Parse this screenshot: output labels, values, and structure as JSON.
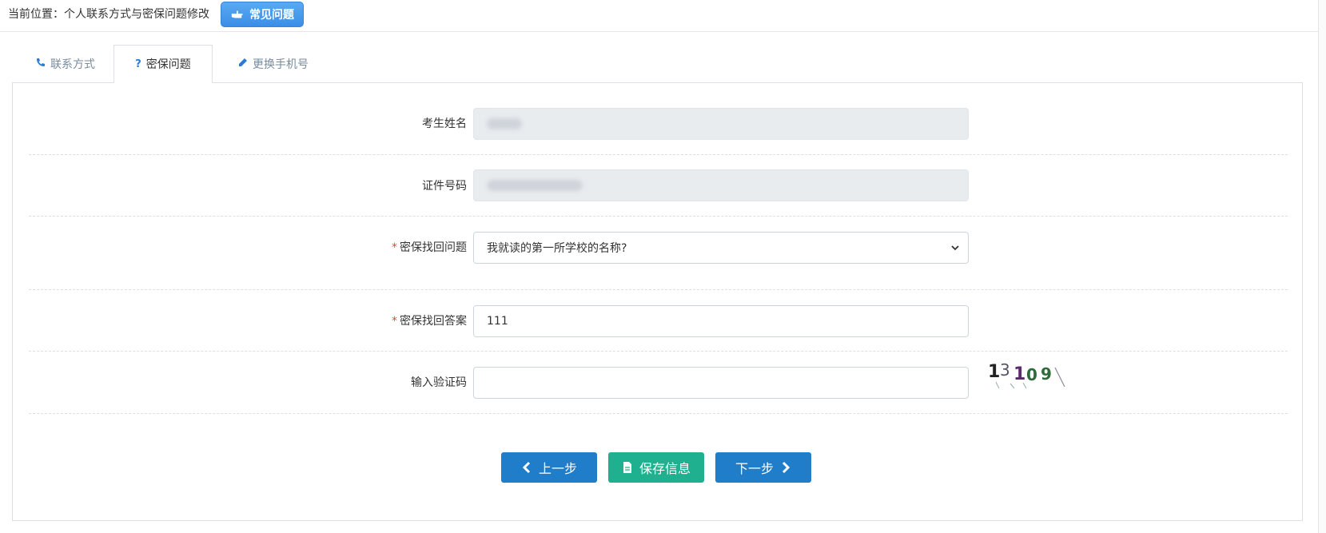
{
  "topbar": {
    "breadcrumb": "当前位置：个人联系方式与密保问题修改",
    "faq_label": "常见问题"
  },
  "tabs": [
    {
      "label": "联系方式",
      "icon": "phone-icon"
    },
    {
      "label": "密保问题",
      "icon": "question-icon"
    },
    {
      "label": "更换手机号",
      "icon": "pencil-icon"
    }
  ],
  "form": {
    "name": {
      "label": "考生姓名",
      "value": ""
    },
    "id_number": {
      "label": "证件号码",
      "value": ""
    },
    "security_question": {
      "label": "密保找回问题",
      "required_mark": "*",
      "value": "我就读的第一所学校的名称?"
    },
    "security_answer": {
      "label": "密保找回答案",
      "required_mark": "*",
      "value": "111"
    },
    "captcha": {
      "label": "输入验证码",
      "value": "",
      "image_text": "13109"
    }
  },
  "buttons": {
    "prev": "上一步",
    "save": "保存信息",
    "next": "下一步"
  },
  "colors": {
    "primary": "#1f7dc9",
    "success": "#1fb18f",
    "required": "#e64545",
    "faq": "#3a8ee6"
  }
}
